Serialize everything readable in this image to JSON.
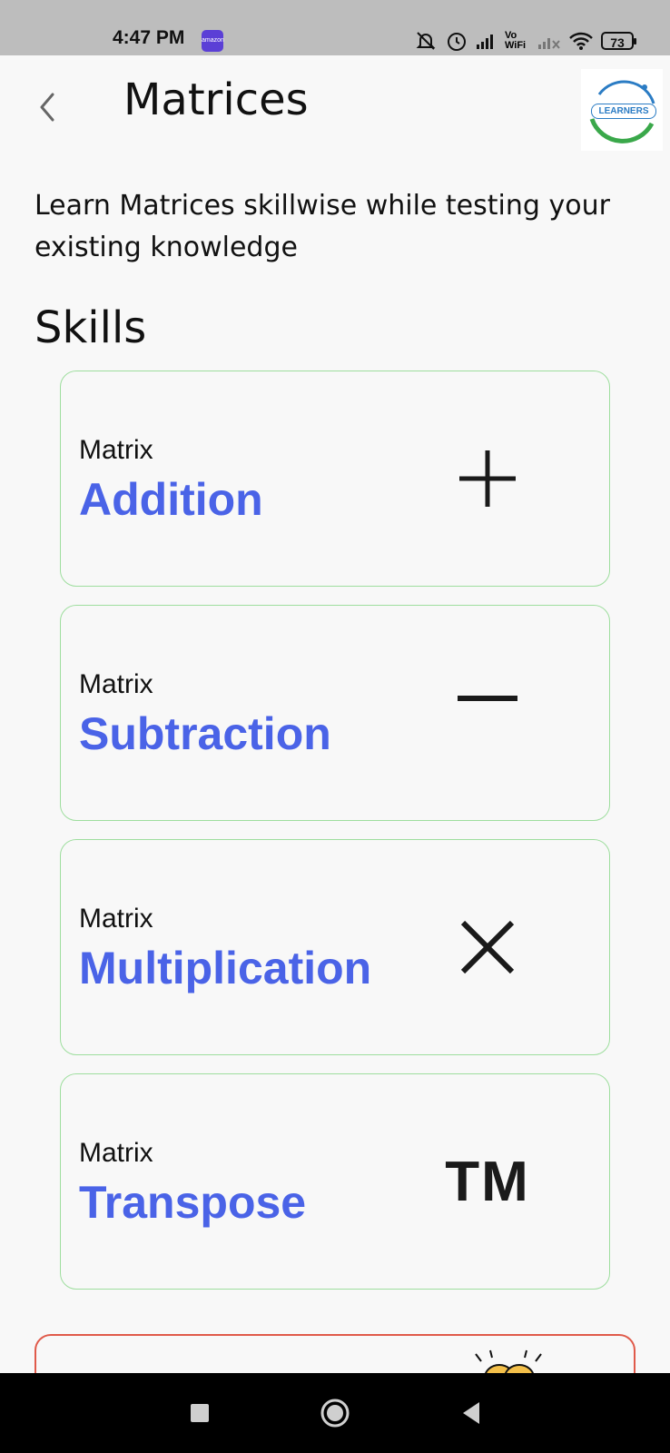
{
  "status_bar": {
    "time": "4:47 PM",
    "app_badge": "amazon",
    "network_label": "Vo WiFi",
    "battery": "73",
    "icons": [
      "bell-off-icon",
      "alarm-icon",
      "signal-icon",
      "vowifi-icon",
      "signal-no-service-icon",
      "wifi-icon",
      "battery-icon"
    ]
  },
  "header": {
    "back_icon": "chevron-left-icon",
    "title": "Matrices",
    "logo_text": "LEARNERS"
  },
  "intro_text": "Learn Matrices skillwise while testing your existing knowledge",
  "skills_heading": "Skills",
  "skills": [
    {
      "kicker": "Matrix",
      "name": "Addition",
      "icon": "plus-icon"
    },
    {
      "kicker": "Matrix",
      "name": "Subtraction",
      "icon": "minus-icon"
    },
    {
      "kicker": "Matrix",
      "name": "Multiplication",
      "icon": "times-icon"
    },
    {
      "kicker": "Matrix",
      "name": "Transpose",
      "icon_text": "TM"
    }
  ],
  "colors": {
    "accent": "#4a63e7",
    "card_border": "#9ede9e",
    "red_card_border": "#e05a4a",
    "status_bar": "#bdbdbd",
    "background": "#f8f8f8"
  },
  "nav_bar": {
    "icons": [
      "recents-square-icon",
      "home-circle-icon",
      "back-triangle-icon"
    ]
  }
}
